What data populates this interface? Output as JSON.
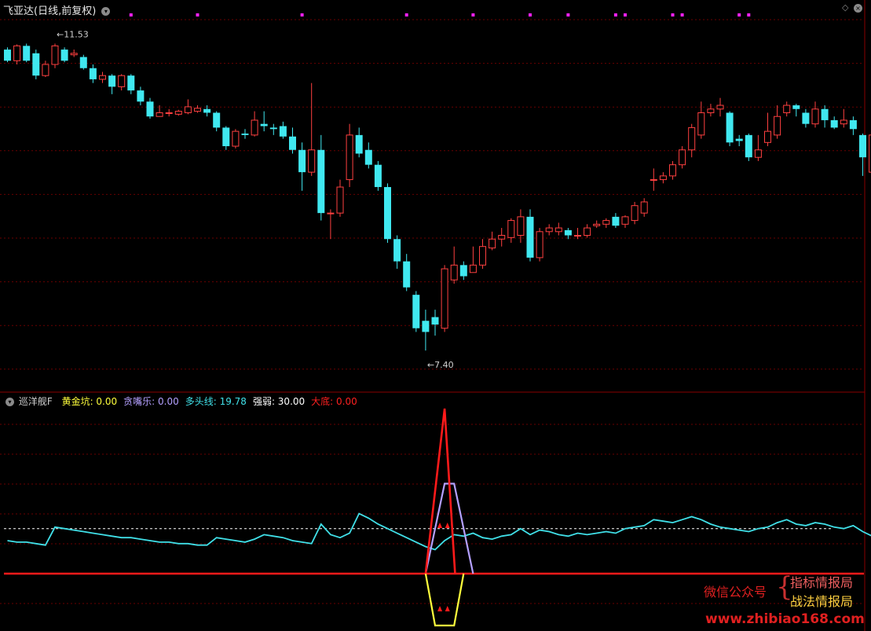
{
  "title_bar": {
    "stock_name": "飞亚达",
    "period": "(日线,前复权)",
    "dropdown_icon": "chevron-down-icon"
  },
  "corner_icons": [
    "diamond-icon",
    "close-icon"
  ],
  "price_labels": {
    "high": "11.53",
    "low": "7.40"
  },
  "indicator": {
    "name": "巡洋舰F",
    "items": [
      {
        "label": "黄金坑:",
        "value": "0.00",
        "color": "#ffff3c"
      },
      {
        "label": "贪嘴乐:",
        "value": "0.00",
        "color": "#b4a0ff"
      },
      {
        "label": "多头线:",
        "value": "19.78",
        "color": "#40e0e8"
      },
      {
        "label": "强弱:",
        "value": "30.00",
        "color": "#ffffff"
      },
      {
        "label": "大底:",
        "value": "0.00",
        "color": "#ff2020"
      }
    ]
  },
  "watermark": {
    "left": "微信公众号",
    "right1": "指标情报局",
    "right2": "战法情报局",
    "url": "www.zhibiao168.com"
  },
  "colors": {
    "up": "#ff4040",
    "down": "#40e8f0",
    "grid": "#6a0000",
    "magenta_marker": "#ff20ff",
    "indicator_red": "#ff1a1a",
    "indicator_cyan": "#40e0e8",
    "indicator_purple": "#b4a0ff",
    "indicator_yellow": "#ffff3c"
  },
  "chart_data": [
    {
      "type": "candlestick",
      "title": "飞亚达(日线,前复权)",
      "ylim": [
        7.2,
        11.8
      ],
      "annotations": [
        {
          "label": "11.53",
          "x": 5,
          "value": 11.53
        },
        {
          "label": "7.40",
          "x": 44,
          "value": 7.4
        }
      ],
      "marker_x": [
        13,
        20,
        31,
        42,
        49,
        55,
        59,
        64,
        65,
        70,
        71,
        77,
        78
      ],
      "candles": [
        [
          11.45,
          11.3,
          11.48,
          11.28
        ],
        [
          11.3,
          11.5,
          11.52,
          11.25
        ],
        [
          11.5,
          11.3,
          11.53,
          11.28
        ],
        [
          11.4,
          11.1,
          11.45,
          11.05
        ],
        [
          11.1,
          11.25,
          11.3,
          11.08
        ],
        [
          11.25,
          11.5,
          11.53,
          11.2
        ],
        [
          11.45,
          11.3,
          11.48,
          11.28
        ],
        [
          11.38,
          11.4,
          11.45,
          11.35
        ],
        [
          11.35,
          11.2,
          11.38,
          11.18
        ],
        [
          11.2,
          11.05,
          11.25,
          11.0
        ],
        [
          11.05,
          11.1,
          11.15,
          11.0
        ],
        [
          11.1,
          10.95,
          11.12,
          10.85
        ],
        [
          10.95,
          11.1,
          11.12,
          10.9
        ],
        [
          11.1,
          10.9,
          11.12,
          10.85
        ],
        [
          10.9,
          10.75,
          10.95,
          10.7
        ],
        [
          10.75,
          10.55,
          10.8,
          10.52
        ],
        [
          10.55,
          10.6,
          10.7,
          10.55
        ],
        [
          10.6,
          10.6,
          10.65,
          10.55
        ],
        [
          10.58,
          10.62,
          10.64,
          10.56
        ],
        [
          10.6,
          10.68,
          10.78,
          10.58
        ],
        [
          10.62,
          10.66,
          10.7,
          10.6
        ],
        [
          10.65,
          10.6,
          10.7,
          10.55
        ],
        [
          10.6,
          10.4,
          10.62,
          10.35
        ],
        [
          10.4,
          10.15,
          10.42,
          10.1
        ],
        [
          10.15,
          10.35,
          10.38,
          10.12
        ],
        [
          10.32,
          10.3,
          10.38,
          10.25
        ],
        [
          10.3,
          10.5,
          10.62,
          10.28
        ],
        [
          10.45,
          10.42,
          10.62,
          10.35
        ],
        [
          10.4,
          10.38,
          10.45,
          10.3
        ],
        [
          10.42,
          10.28,
          10.48,
          10.25
        ],
        [
          10.28,
          10.1,
          10.4,
          10.05
        ],
        [
          10.1,
          9.8,
          10.2,
          9.55
        ],
        [
          9.8,
          10.1,
          11.0,
          9.75
        ],
        [
          10.1,
          9.25,
          10.3,
          9.15
        ],
        [
          9.25,
          9.25,
          9.3,
          8.9
        ],
        [
          9.25,
          9.6,
          9.7,
          9.2
        ],
        [
          9.7,
          10.3,
          10.45,
          9.6
        ],
        [
          10.3,
          10.05,
          10.4,
          10.0
        ],
        [
          10.1,
          9.9,
          10.2,
          9.85
        ],
        [
          9.9,
          9.6,
          9.95,
          9.55
        ],
        [
          9.6,
          8.9,
          9.65,
          8.85
        ],
        [
          8.9,
          8.6,
          8.95,
          8.5
        ],
        [
          8.6,
          8.25,
          8.7,
          8.2
        ],
        [
          8.15,
          7.7,
          8.2,
          7.65
        ],
        [
          7.8,
          7.65,
          7.95,
          7.4
        ],
        [
          7.85,
          7.75,
          7.95,
          7.6
        ],
        [
          7.7,
          8.5,
          8.55,
          7.65
        ],
        [
          8.35,
          8.55,
          8.8,
          8.3
        ],
        [
          8.55,
          8.4,
          8.6,
          8.35
        ],
        [
          8.45,
          8.55,
          8.8,
          8.45
        ],
        [
          8.55,
          8.8,
          8.9,
          8.5
        ],
        [
          8.78,
          8.9,
          9.0,
          8.75
        ],
        [
          8.9,
          8.95,
          9.05,
          8.8
        ],
        [
          8.92,
          9.15,
          9.18,
          8.85
        ],
        [
          8.95,
          9.2,
          9.3,
          8.85
        ],
        [
          9.2,
          8.65,
          9.3,
          8.6
        ],
        [
          8.65,
          9.0,
          9.05,
          8.6
        ],
        [
          9.0,
          9.05,
          9.1,
          8.95
        ],
        [
          9.0,
          9.05,
          9.12,
          8.95
        ],
        [
          9.02,
          8.95,
          9.05,
          8.9
        ],
        [
          8.95,
          8.95,
          9.05,
          8.9
        ],
        [
          8.95,
          9.05,
          9.1,
          8.92
        ],
        [
          9.08,
          9.1,
          9.15,
          9.05
        ],
        [
          9.1,
          9.15,
          9.18,
          9.05
        ],
        [
          9.2,
          9.08,
          9.25,
          9.05
        ],
        [
          9.1,
          9.2,
          9.22,
          9.05
        ],
        [
          9.15,
          9.35,
          9.4,
          9.1
        ],
        [
          9.25,
          9.4,
          9.45,
          9.2
        ],
        [
          9.7,
          9.7,
          9.85,
          9.55
        ],
        [
          9.7,
          9.75,
          9.8,
          9.65
        ],
        [
          9.75,
          9.9,
          9.95,
          9.7
        ],
        [
          9.9,
          10.1,
          10.15,
          9.85
        ],
        [
          10.1,
          10.4,
          10.45,
          10.0
        ],
        [
          10.3,
          10.6,
          10.75,
          10.25
        ],
        [
          10.6,
          10.65,
          10.72,
          10.55
        ],
        [
          10.65,
          10.7,
          10.8,
          10.55
        ],
        [
          10.6,
          10.2,
          10.62,
          10.15
        ],
        [
          10.25,
          10.22,
          10.3,
          10.15
        ],
        [
          10.3,
          10.0,
          10.32,
          9.95
        ],
        [
          10.0,
          10.1,
          10.3,
          9.95
        ],
        [
          10.2,
          10.35,
          10.6,
          10.15
        ],
        [
          10.3,
          10.55,
          10.7,
          10.25
        ],
        [
          10.6,
          10.7,
          10.75,
          10.55
        ],
        [
          10.7,
          10.65,
          10.72,
          10.55
        ],
        [
          10.6,
          10.45,
          10.65,
          10.4
        ],
        [
          10.45,
          10.65,
          10.75,
          10.4
        ],
        [
          10.65,
          10.5,
          10.7,
          10.4
        ],
        [
          10.5,
          10.4,
          10.55,
          10.38
        ],
        [
          10.45,
          10.5,
          10.65,
          10.4
        ],
        [
          10.5,
          10.38,
          10.55,
          10.3
        ],
        [
          10.3,
          10.0,
          10.32,
          9.75
        ],
        [
          9.8,
          10.3,
          10.4,
          9.75
        ],
        [
          10.3,
          10.4,
          10.55,
          10.28
        ]
      ]
    },
    {
      "type": "line",
      "title": "巡洋舰F",
      "ylim": [
        0,
        110
      ],
      "reference_line": 30,
      "series": [
        {
          "name": "多头线",
          "color": "#40e0e8",
          "values": [
            22,
            21,
            21,
            20,
            19,
            31,
            30,
            29,
            28,
            27,
            26,
            25,
            24,
            24,
            23,
            22,
            21,
            21,
            20,
            20,
            19,
            19,
            24,
            23,
            22,
            21,
            23,
            26,
            25,
            24,
            22,
            21,
            20,
            33,
            26,
            24,
            27,
            40,
            37,
            33,
            30,
            27,
            24,
            21,
            18,
            16,
            22,
            26,
            25,
            27,
            24,
            23,
            25,
            26,
            30,
            26,
            29,
            28,
            26,
            25,
            27,
            26,
            27,
            28,
            27,
            30,
            31,
            32,
            36,
            35,
            34,
            36,
            38,
            36,
            33,
            31,
            30,
            29,
            28,
            30,
            31,
            34,
            36,
            33,
            32,
            34,
            33,
            31,
            30,
            32,
            28,
            25,
            26,
            29
          ]
        },
        {
          "name": "贪嘴乐",
          "color": "#b4a0ff",
          "values": [
            0,
            0,
            0,
            0,
            0,
            0,
            0,
            0,
            0,
            0,
            0,
            0,
            0,
            0,
            0,
            0,
            0,
            0,
            0,
            0,
            0,
            0,
            0,
            0,
            0,
            0,
            0,
            0,
            0,
            0,
            0,
            0,
            0,
            0,
            0,
            0,
            0,
            0,
            0,
            0,
            0,
            0,
            0,
            0,
            0,
            30,
            60,
            60,
            30,
            0,
            0,
            0,
            0,
            0,
            0,
            0,
            0,
            0,
            0,
            0,
            0,
            0,
            0,
            0,
            0,
            0,
            0,
            0,
            0,
            0,
            0,
            0,
            0,
            0,
            0,
            0,
            0,
            0,
            0,
            0,
            0,
            0,
            0,
            0,
            0,
            0,
            0,
            0,
            0,
            0,
            0,
            0,
            0,
            0,
            0,
            0,
            0,
            0,
            0,
            0
          ]
        },
        {
          "name": "强弱",
          "color": "#ffffff",
          "values": [
            30
          ]
        },
        {
          "name": "大底",
          "color": "#ff1a1a",
          "values": [
            0,
            0,
            0,
            0,
            0,
            0,
            0,
            0,
            0,
            0,
            0,
            0,
            0,
            0,
            0,
            0,
            0,
            0,
            0,
            0,
            0,
            0,
            0,
            0,
            0,
            0,
            0,
            0,
            0,
            0,
            0,
            0,
            0,
            0,
            0,
            0,
            0,
            0,
            0,
            0,
            0,
            0,
            0,
            0,
            0,
            0,
            110,
            0,
            0,
            0,
            0,
            0,
            0,
            0,
            0,
            0,
            0,
            0,
            0,
            0,
            0,
            0,
            0,
            0,
            0,
            0,
            0,
            0,
            0,
            0,
            0,
            0,
            0,
            0,
            0,
            0,
            0,
            0,
            0,
            0,
            0,
            0,
            0,
            0,
            0,
            0,
            0,
            0,
            0,
            0,
            0,
            0,
            0,
            0,
            0,
            0,
            0,
            0,
            0,
            0
          ]
        },
        {
          "name": "黄金坑",
          "color": "#ffff3c",
          "values": [
            0,
            0,
            0,
            0,
            0,
            0,
            0,
            0,
            0,
            0,
            0,
            0,
            0,
            0,
            0,
            0,
            0,
            0,
            0,
            0,
            0,
            0,
            0,
            0,
            0,
            0,
            0,
            0,
            0,
            0,
            0,
            0,
            0,
            0,
            0,
            0,
            0,
            0,
            0,
            0,
            0,
            0,
            0,
            0,
            0,
            -40,
            -40,
            -40,
            0,
            0,
            0,
            0,
            0,
            0,
            0,
            0,
            0,
            0,
            0,
            0,
            0,
            0,
            0,
            0,
            0,
            0,
            0,
            0,
            0,
            0,
            0,
            0,
            0,
            0,
            0,
            0,
            0,
            0,
            0,
            0,
            0,
            0,
            0,
            0,
            0,
            0,
            0,
            0,
            0,
            0,
            0,
            0,
            0,
            0,
            0,
            0,
            0,
            0,
            0,
            0
          ]
        }
      ]
    }
  ]
}
